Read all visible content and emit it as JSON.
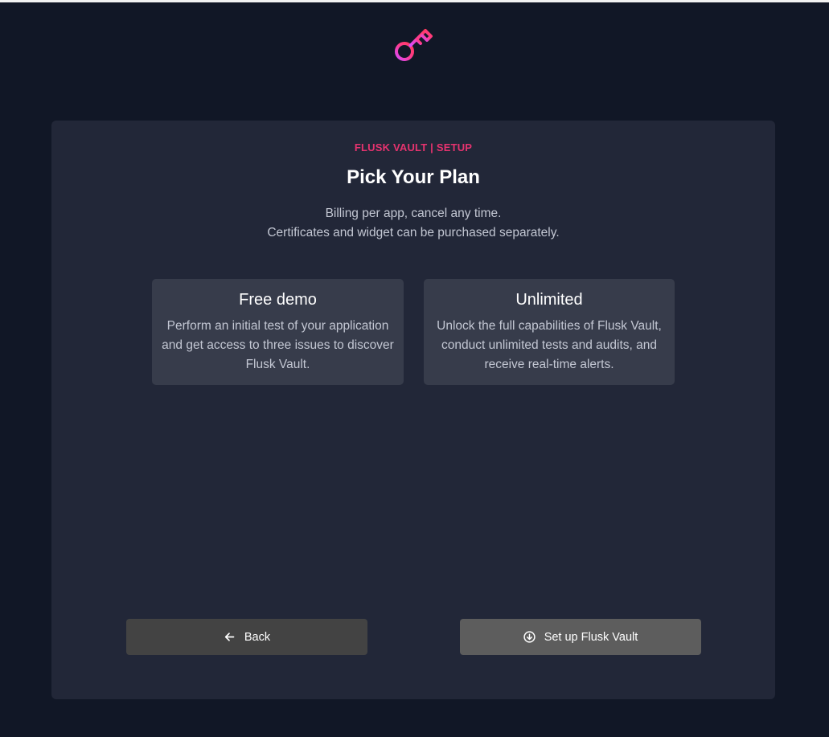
{
  "logo": {
    "icon": "key-icon",
    "gradient": [
      "#ff3b6b",
      "#d84cff"
    ]
  },
  "header": {
    "eyebrow": "FLUSK VAULT | SETUP",
    "title": "Pick Your Plan",
    "subtitle_line1": "Billing per app, cancel any time.",
    "subtitle_line2": "Certificates and widget can be purchased separately."
  },
  "plans": [
    {
      "name": "Free demo",
      "description": "Perform an initial test of your application and get access to three issues to discover Flusk Vault."
    },
    {
      "name": "Unlimited",
      "description": "Unlock the full capabilities of Flusk Vault, conduct unlimited tests and audits, and receive real-time alerts."
    }
  ],
  "actions": {
    "back_label": "Back",
    "back_icon": "arrow-left-icon",
    "setup_label": "Set up Flusk Vault",
    "setup_icon": "circle-arrow-down-icon"
  },
  "colors": {
    "background": "#111726",
    "card": "#222738",
    "plan_card": "#373c4b",
    "accent": "#e6336f",
    "back_button": "#434343",
    "setup_button": "#5d5d5d"
  }
}
